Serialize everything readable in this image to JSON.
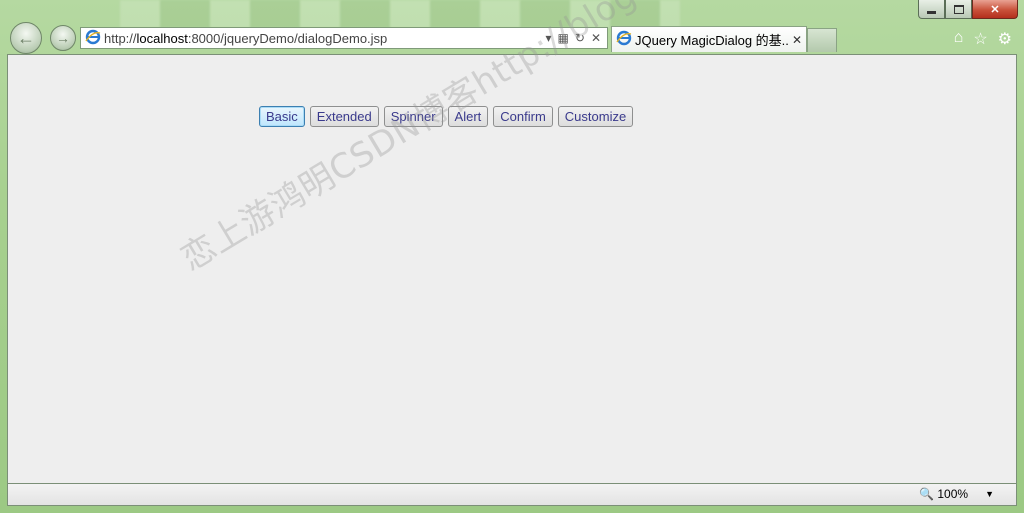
{
  "browser": {
    "address": {
      "prefix": "http://",
      "host": "localhost",
      "rest": ":8000/jqueryDemo/dialogDemo.jsp"
    },
    "tab": {
      "title": "JQuery MagicDialog 的基..."
    }
  },
  "page": {
    "buttons": [
      "Basic",
      "Extended",
      "Spinner",
      "Alert",
      "Confirm",
      "Customize"
    ],
    "watermark": "恋上游鸿明CSDN博客http://blog.csdn.net/youqishini"
  },
  "status": {
    "zoom": "100%"
  },
  "icons": {
    "back": "back-arrow-icon",
    "forward": "forward-arrow-icon",
    "ie": "ie-logo-icon",
    "home": "home-icon",
    "favorites": "star-icon",
    "tools": "gear-icon"
  }
}
